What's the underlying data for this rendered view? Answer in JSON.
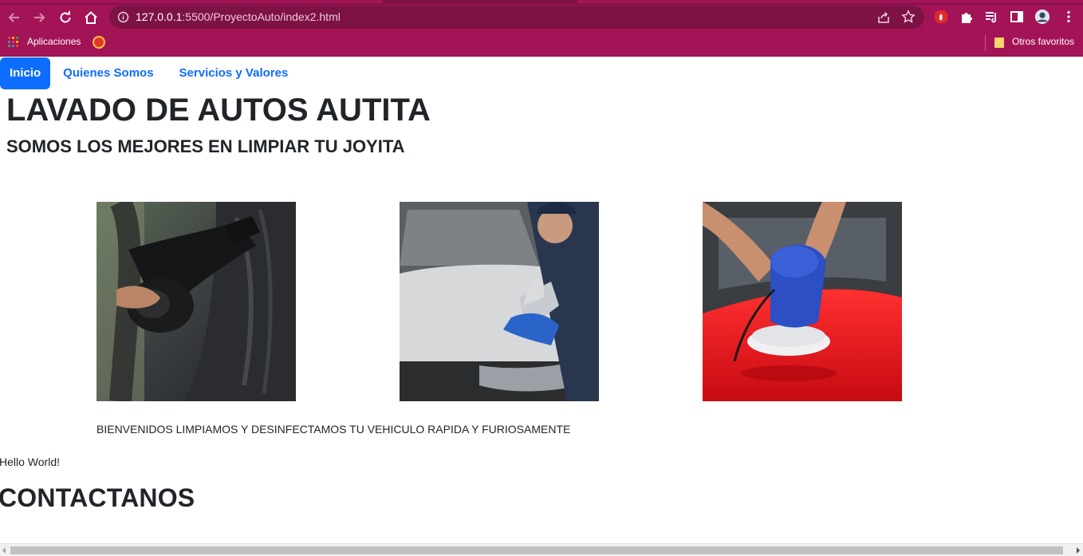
{
  "browser": {
    "url_host": "127.0.0.1",
    "url_rest": ":5500/ProyectoAuto/index2.html",
    "bookmarks": {
      "apps_label": "Aplicaciones",
      "other_label": "Otros favoritos"
    },
    "theme_color": "#a31456"
  },
  "nav": {
    "items": [
      {
        "label": "Inicio",
        "active": true
      },
      {
        "label": "Quienes Somos",
        "active": false
      },
      {
        "label": "Servicios y Valores",
        "active": false
      }
    ],
    "accent": "#0d6efd"
  },
  "hero": {
    "title": "LAVADO DE AUTOS AUTITA",
    "subtitle": "SOMOS LOS MEJORES EN LIMPIAR TU JOYITA"
  },
  "gallery": [
    {
      "icon": "vacuum-cleaning-photo"
    },
    {
      "icon": "hood-wiping-photo"
    },
    {
      "icon": "car-polishing-photo"
    }
  ],
  "welcome_text": "BIENVENIDOS LIMPIAMOS Y DESINFECTAMOS TU VEHICULO RAPIDA Y FURIOSAMENTE",
  "hello_text": "Hello World!",
  "contact_heading": "CONTACTANOS"
}
